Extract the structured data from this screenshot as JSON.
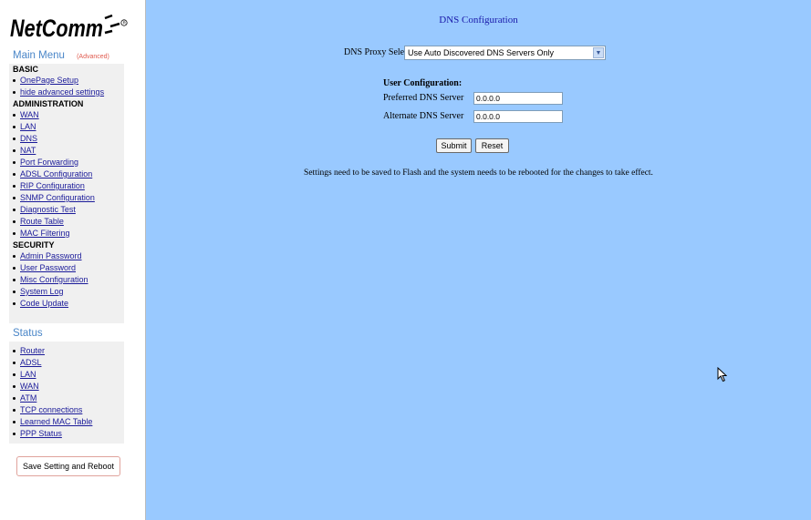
{
  "sidebar": {
    "brand": "NetComm",
    "main_menu": "Main Menu",
    "advanced_tag": "(Advanced)",
    "basic": {
      "title": "BASIC",
      "items": [
        "OnePage Setup",
        "hide advanced settings"
      ]
    },
    "administration": {
      "title": "ADMINISTRATION",
      "items": [
        "WAN",
        "LAN",
        "DNS",
        "NAT",
        "Port Forwarding",
        "ADSL Configuration",
        "RIP Configuration",
        "SNMP Configuration",
        "Diagnostic Test",
        "Route Table",
        "MAC Filtering"
      ]
    },
    "security": {
      "title": "SECURITY",
      "items": [
        "Admin Password",
        "User Password",
        "Misc Configuration",
        "System Log",
        "Code Update"
      ]
    },
    "status_title": "Status",
    "status_items": [
      "Router",
      "ADSL",
      "LAN",
      "WAN",
      "ATM",
      "TCP connections",
      "Learned MAC Table",
      "PPP Status"
    ],
    "save_button": "Save Setting and Reboot"
  },
  "main": {
    "title": "DNS Configuration",
    "proxy_label": "DNS Proxy Selection",
    "proxy_value": "Use Auto Discovered DNS Servers Only",
    "user_config_title": "User Configuration:",
    "preferred_label": "Preferred DNS Server",
    "preferred_value": "0.0.0.0",
    "alternate_label": "Alternate DNS Server",
    "alternate_value": "0.0.0.0",
    "submit_label": "Submit",
    "reset_label": "Reset",
    "note": "Settings need to be saved to Flash and the system needs to be rebooted for the changes to take effect."
  },
  "colors": {
    "main_bg": "#99c9ff",
    "title": "#1a1aaa",
    "menu_head": "#4a86c8",
    "advanced_tag": "#e05a4e",
    "link": "#1a1a99"
  }
}
